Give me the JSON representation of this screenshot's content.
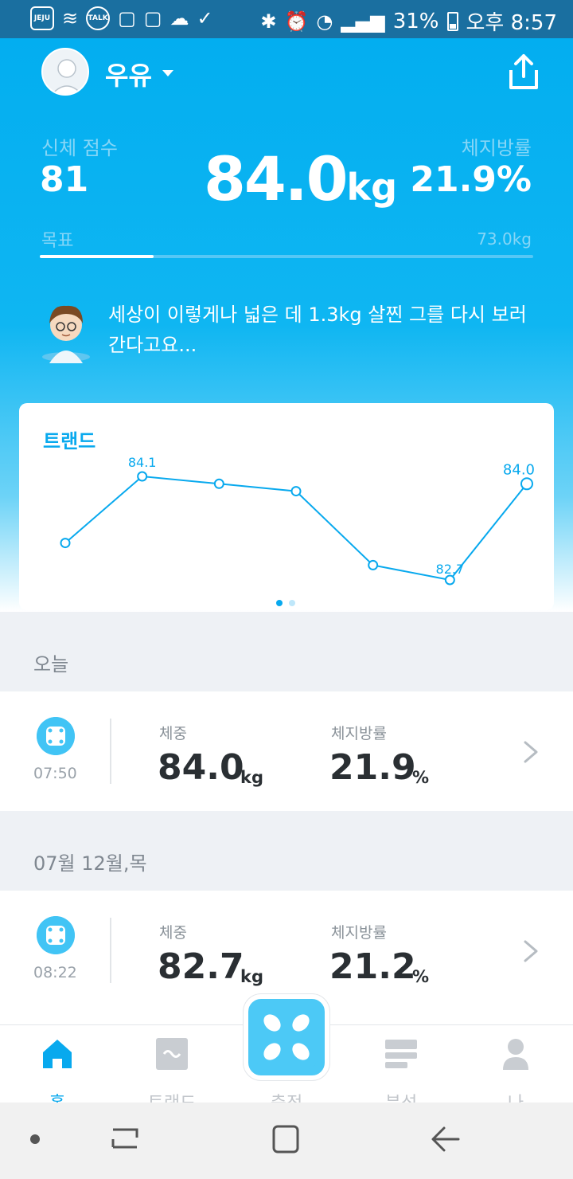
{
  "status_bar": {
    "battery": "31%",
    "time": "오후 8:57",
    "notif_icons": [
      "jeju-air-icon",
      "wifi-calling-icon",
      "kakaotalk-icon",
      "notification-icon",
      "notification-icon",
      "weather-icon",
      "check-icon"
    ],
    "jeju_text": "JEJU",
    "talk_text": "TALK"
  },
  "header": {
    "username": "우유"
  },
  "summary": {
    "score_label": "신체 점수",
    "score_value": "81",
    "weight_value": "84.0",
    "weight_unit": "kg",
    "fat_label": "체지방률",
    "fat_value": "21.9%",
    "goal_label": "목표",
    "goal_value": "73.0kg",
    "goal_progress_pct": 23
  },
  "coach": {
    "message": "세상이 이렇게나 넓은 데 1.3kg 살찐 그를 다시 보러 간다고요..."
  },
  "trend": {
    "title": "트랜드",
    "page_count": 2,
    "active_page": 0
  },
  "chart_data": {
    "type": "line",
    "title": "트랜드",
    "series": [
      {
        "values": [
          83.2,
          84.1,
          84.0,
          83.9,
          82.9,
          82.7,
          84.0
        ]
      }
    ],
    "data_labels": [
      {
        "index": 1,
        "text": "84.1"
      },
      {
        "index": 5,
        "text": "82.7"
      },
      {
        "index": 6,
        "text": "84.0"
      }
    ],
    "color": "#08a9ee",
    "grid": false
  },
  "records": [
    {
      "day_label": "오늘",
      "time": "07:50",
      "weight_label": "체중",
      "weight_value": "84.0",
      "weight_unit": "kg",
      "fat_label": "체지방률",
      "fat_value": "21.9",
      "fat_unit": "%"
    },
    {
      "day_label": "07월 12월,목",
      "time": "08:22",
      "weight_label": "체중",
      "weight_value": "82.7",
      "weight_unit": "kg",
      "fat_label": "체지방률",
      "fat_value": "21.2",
      "fat_unit": "%"
    }
  ],
  "bottom_nav": {
    "items": [
      {
        "label": "홈",
        "icon": "home-icon",
        "active": true
      },
      {
        "label": "트랜드",
        "icon": "trend-icon",
        "active": false
      },
      {
        "label": "측정",
        "icon": "scale-icon",
        "active": false
      },
      {
        "label": "분석",
        "icon": "analysis-icon",
        "active": false
      },
      {
        "label": "나",
        "icon": "person-icon",
        "active": false
      }
    ]
  },
  "colors": {
    "accent": "#08a9ee",
    "hero_top": "#03aef0",
    "text_dark": "#2a2f33"
  }
}
